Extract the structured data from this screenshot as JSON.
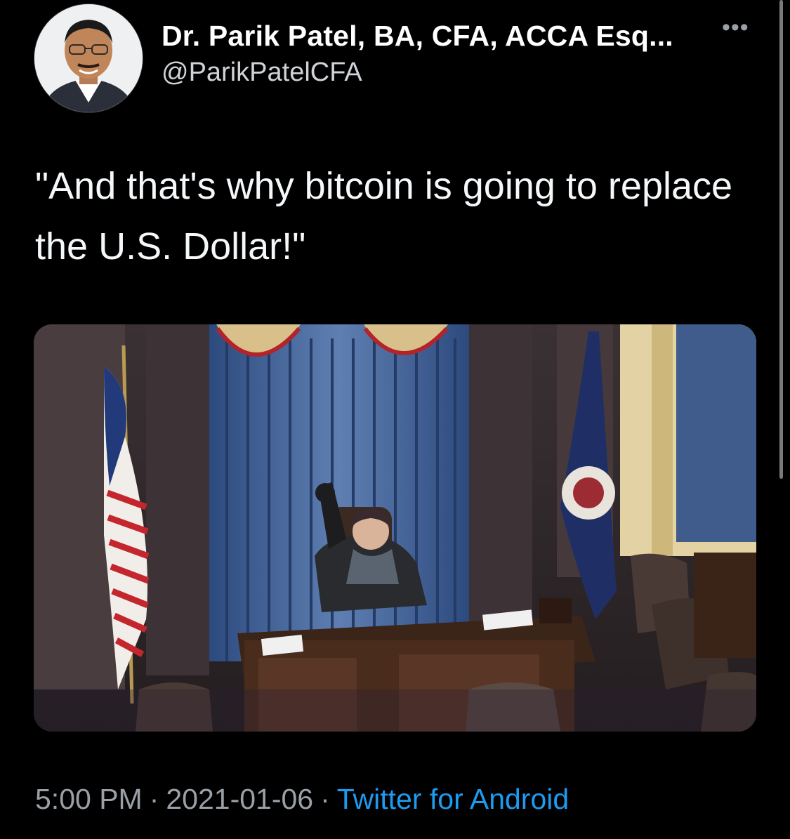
{
  "author": {
    "display_name": "Dr. Parik Patel, BA, CFA, ACCA Esq...",
    "handle": "@ParikPatelCFA"
  },
  "actions": {
    "more_label": "•••"
  },
  "tweet": {
    "text": "\"And that's why bitcoin is going to replace the U.S. Dollar!\""
  },
  "meta": {
    "time": "5:00 PM",
    "separator": "·",
    "date": "2021-01-06",
    "source": "Twitter for Android"
  },
  "colors": {
    "background": "#000000",
    "link": "#1d9bf0",
    "secondary_text": "#9aa0a6"
  }
}
